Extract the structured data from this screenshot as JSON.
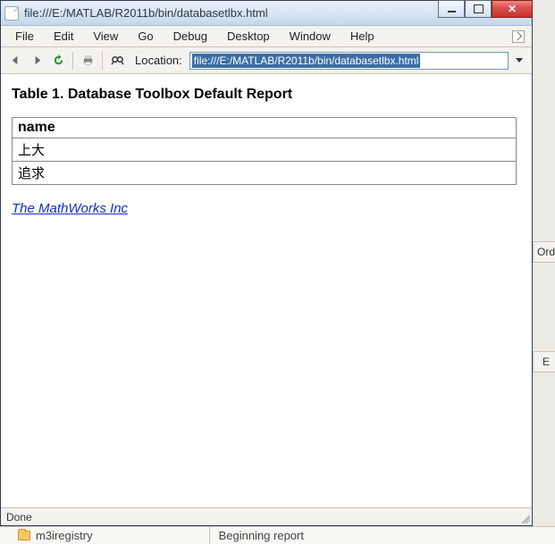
{
  "window": {
    "title": "file:///E:/MATLAB/R2011b/bin/databasetlbx.html"
  },
  "menu": {
    "items": [
      "File",
      "Edit",
      "View",
      "Go",
      "Debug",
      "Desktop",
      "Window",
      "Help"
    ]
  },
  "toolbar": {
    "location_label": "Location:",
    "location_value": "file:///E:/MATLAB/R2011b/bin/databasetlbx.html"
  },
  "page": {
    "heading": "Table 1. Database Toolbox Default Report",
    "table": {
      "header": "name",
      "rows": [
        "上大",
        "追求"
      ]
    },
    "link_text": "The MathWorks Inc"
  },
  "status": {
    "text": "Done"
  },
  "background": {
    "label_order": "Orde",
    "label_e": "E",
    "folder": "m3iregistry",
    "beginning": "Beginning report"
  }
}
